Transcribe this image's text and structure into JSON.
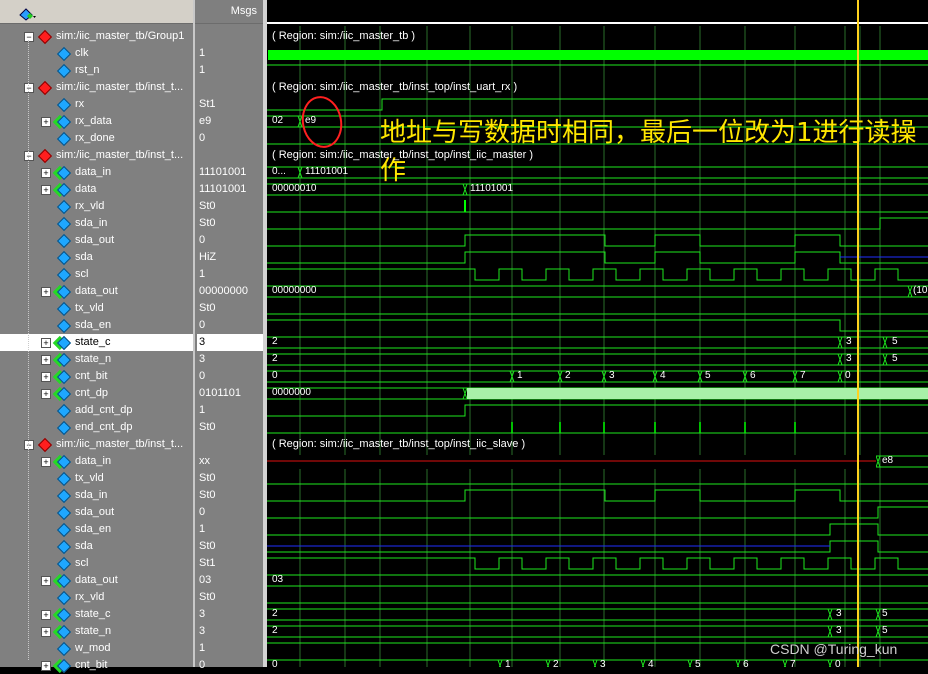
{
  "header": {
    "msgs_label": "Msgs"
  },
  "signals": [
    {
      "name": "sim:/iic_master_tb/Group1",
      "value": "",
      "kind": "group"
    },
    {
      "name": "clk",
      "value": "1",
      "kind": "sig"
    },
    {
      "name": "rst_n",
      "value": "1",
      "kind": "sig"
    },
    {
      "name": "sim:/iic_master_tb/inst_t...",
      "value": "",
      "kind": "group"
    },
    {
      "name": "rx",
      "value": "St1",
      "kind": "sig"
    },
    {
      "name": "rx_data",
      "value": "e9",
      "kind": "bus"
    },
    {
      "name": "rx_done",
      "value": "0",
      "kind": "sig"
    },
    {
      "name": "sim:/iic_master_tb/inst_t...",
      "value": "",
      "kind": "group"
    },
    {
      "name": "data_in",
      "value": "11101001",
      "kind": "bus"
    },
    {
      "name": "data",
      "value": "11101001",
      "kind": "bus"
    },
    {
      "name": "rx_vld",
      "value": "St0",
      "kind": "sig"
    },
    {
      "name": "sda_in",
      "value": "St0",
      "kind": "sig"
    },
    {
      "name": "sda_out",
      "value": "0",
      "kind": "sig"
    },
    {
      "name": "sda",
      "value": "HiZ",
      "kind": "sig"
    },
    {
      "name": "scl",
      "value": "1",
      "kind": "sig"
    },
    {
      "name": "data_out",
      "value": "00000000",
      "kind": "bus"
    },
    {
      "name": "tx_vld",
      "value": "St0",
      "kind": "sig"
    },
    {
      "name": "sda_en",
      "value": "0",
      "kind": "sig"
    },
    {
      "name": "state_c",
      "value": "3",
      "kind": "bus",
      "selected": true
    },
    {
      "name": "state_n",
      "value": "3",
      "kind": "bus"
    },
    {
      "name": "cnt_bit",
      "value": "0",
      "kind": "bus"
    },
    {
      "name": "cnt_dp",
      "value": "0101101",
      "kind": "bus"
    },
    {
      "name": "add_cnt_dp",
      "value": "1",
      "kind": "sig"
    },
    {
      "name": "end_cnt_dp",
      "value": "St0",
      "kind": "sig"
    },
    {
      "name": "sim:/iic_master_tb/inst_t...",
      "value": "",
      "kind": "group"
    },
    {
      "name": "data_in",
      "value": "xx",
      "kind": "bus"
    },
    {
      "name": "tx_vld",
      "value": "St0",
      "kind": "sig"
    },
    {
      "name": "sda_in",
      "value": "St0",
      "kind": "sig"
    },
    {
      "name": "sda_out",
      "value": "0",
      "kind": "sig"
    },
    {
      "name": "sda_en",
      "value": "1",
      "kind": "sig"
    },
    {
      "name": "sda",
      "value": "St0",
      "kind": "sig"
    },
    {
      "name": "scl",
      "value": "St1",
      "kind": "sig"
    },
    {
      "name": "data_out",
      "value": "03",
      "kind": "bus"
    },
    {
      "name": "rx_vld",
      "value": "St0",
      "kind": "sig"
    },
    {
      "name": "state_c",
      "value": "3",
      "kind": "bus"
    },
    {
      "name": "state_n",
      "value": "3",
      "kind": "bus"
    },
    {
      "name": "w_mod",
      "value": "1",
      "kind": "sig"
    },
    {
      "name": "cnt_bit",
      "value": "0",
      "kind": "bus"
    }
  ],
  "wave": {
    "regions": [
      {
        "text": "( Region: sim:/iic_master_tb )",
        "row": 1
      },
      {
        "text": "( Region: sim:/iic_master_tb/inst_top/inst_uart_rx )",
        "row": 4
      },
      {
        "text": "( Region: sim:/iic_master_tb/inst_top/inst_iic_master )",
        "row": 8
      },
      {
        "text": "( Region: sim:/iic_master_tb/inst_top/inst_iic_slave )",
        "row": 25
      }
    ],
    "labels": {
      "rx_data_a": "02",
      "rx_data_b": "e9",
      "m_data_in_a": "0...",
      "m_data_in_b": "11101001",
      "m_data_a": "00000010",
      "m_data_b": "11101001",
      "m_data_out": "00000000",
      "m_data_out_b": "(10",
      "m_state_c_a": "2",
      "m_state_c_b": "3",
      "m_state_c_c": "5",
      "m_state_n_a": "2",
      "m_state_n_b": "3",
      "m_state_n_c": "5",
      "m_cnt_bit": [
        "0",
        "1",
        "2",
        "3",
        "4",
        "5",
        "6",
        "7",
        "0"
      ],
      "m_cnt_dp": "0000000",
      "s_data_in": "e8",
      "s_data_out": "03",
      "s_state_c_a": "2",
      "s_state_c_b": "3",
      "s_state_c_c": "5",
      "s_state_n_a": "2",
      "s_state_n_b": "3",
      "s_state_n_c": "5",
      "s_cnt_bit": [
        "0",
        "1",
        "2",
        "3",
        "4",
        "5",
        "6",
        "7",
        "0"
      ]
    },
    "colors": {
      "green": "#1ee81e",
      "bright": "#00ff00",
      "cursor": "#ffd21e",
      "blue": "#2030ff",
      "red": "#e01010",
      "grid": "#2a6e2a",
      "fill": "#a8f0a8"
    }
  },
  "annotation": "地址与写数据时相同，最后一位改为1进行读操作",
  "watermark": "CSDN @Turing_kun"
}
